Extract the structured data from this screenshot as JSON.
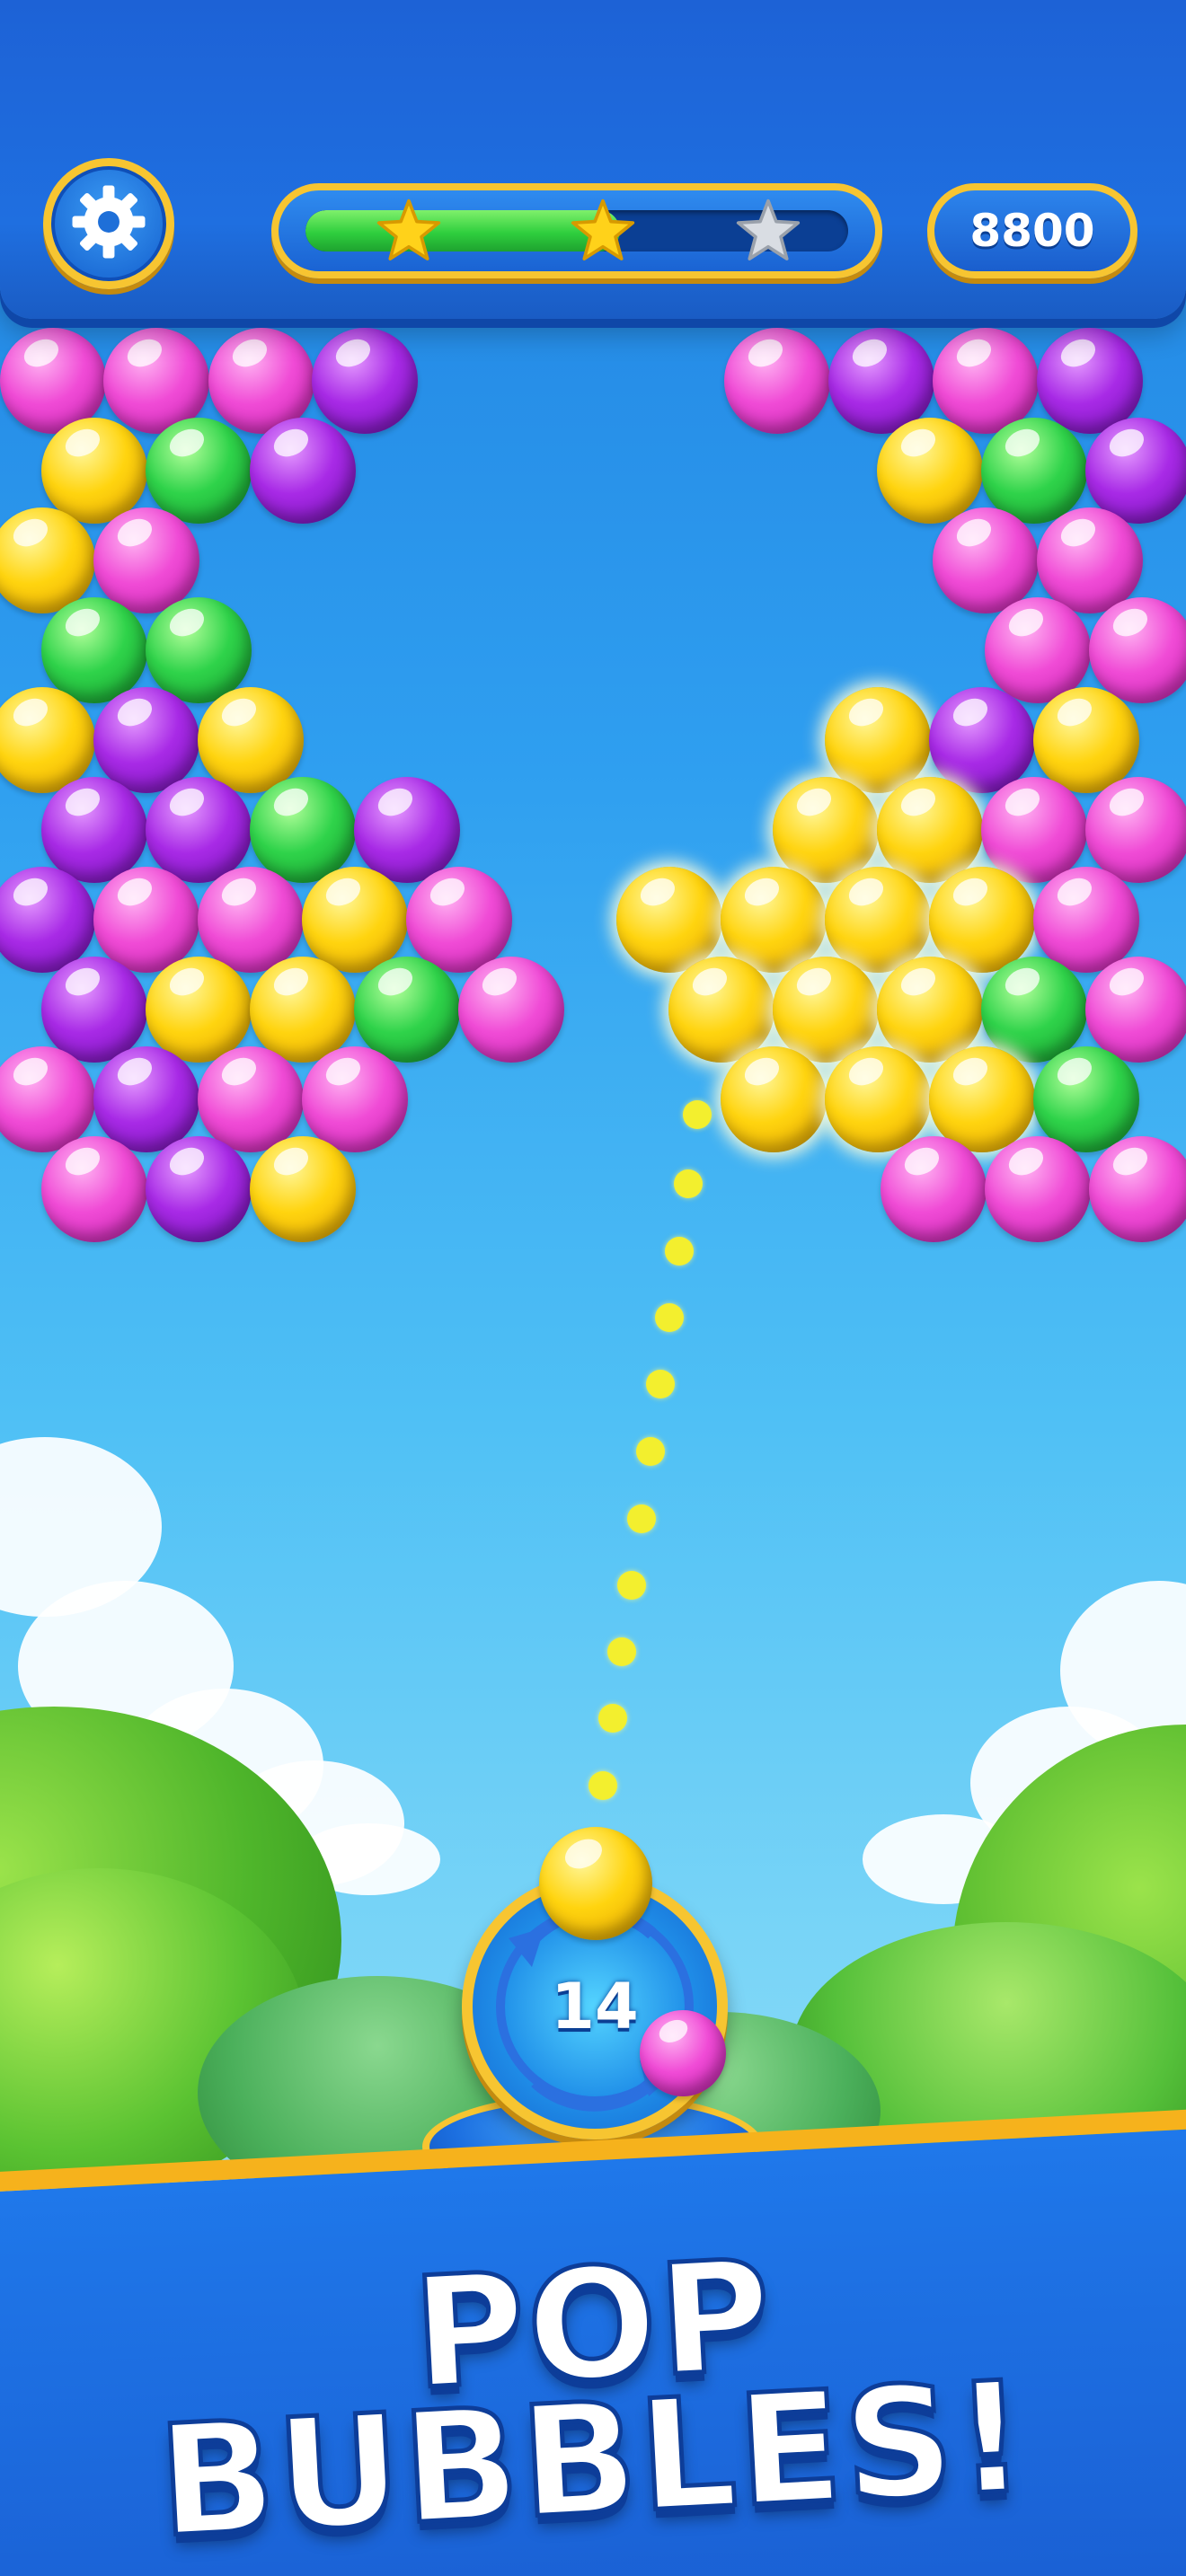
{
  "top_bar": {
    "settings_icon": "gear-icon",
    "progress": {
      "fill_fraction": 0.58,
      "stars": [
        {
          "icon": "star-icon",
          "earned": true
        },
        {
          "icon": "star-icon",
          "earned": true
        },
        {
          "icon": "star-icon",
          "earned": false
        }
      ]
    },
    "score": "8800"
  },
  "launcher": {
    "shots_left": "14",
    "current_bubble": "yellow",
    "next_bubble": "pink",
    "swap_icon": "swap-arrows-icon"
  },
  "headline": {
    "line1": "POP",
    "line2": "BUBBLES!"
  },
  "colors": {
    "pink": "#f04bd6",
    "purple": "#a82ae6",
    "yellow": "#ffd40f",
    "green": "#2fd34a",
    "accent_gold": "#f7c531",
    "brand_blue": "#1f6fe0"
  }
}
